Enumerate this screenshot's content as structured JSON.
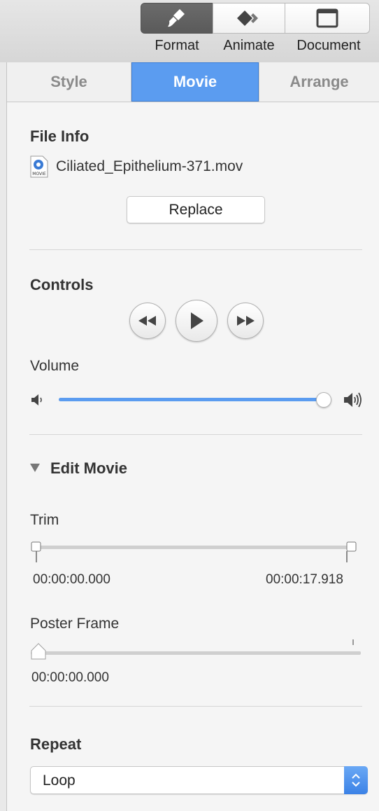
{
  "toolbar": {
    "buttons": [
      {
        "label": "Format",
        "icon": "paintbrush-icon",
        "selected": true
      },
      {
        "label": "Animate",
        "icon": "animate-diamond-icon",
        "selected": false
      },
      {
        "label": "Document",
        "icon": "document-icon",
        "selected": false
      }
    ]
  },
  "tabs": [
    {
      "label": "Style",
      "selected": false
    },
    {
      "label": "Movie",
      "selected": true
    },
    {
      "label": "Arrange",
      "selected": false
    }
  ],
  "file_info": {
    "heading": "File Info",
    "file_icon_text": "MOVIE",
    "file_name": "Ciliated_Epithelium-371.mov",
    "replace_label": "Replace"
  },
  "controls": {
    "heading": "Controls",
    "volume_label": "Volume",
    "volume_level": 1.0
  },
  "edit_movie": {
    "heading": "Edit Movie",
    "expanded": true,
    "trim_label": "Trim",
    "trim_start": "00:00:00.000",
    "trim_end": "00:00:17.918",
    "poster_label": "Poster Frame",
    "poster_time": "00:00:00.000",
    "poster_position": 0.0
  },
  "repeat": {
    "heading": "Repeat",
    "selected": "Loop"
  },
  "colors": {
    "accent": "#5b9cf0",
    "toolbar_selected": "#5f5f5f"
  }
}
